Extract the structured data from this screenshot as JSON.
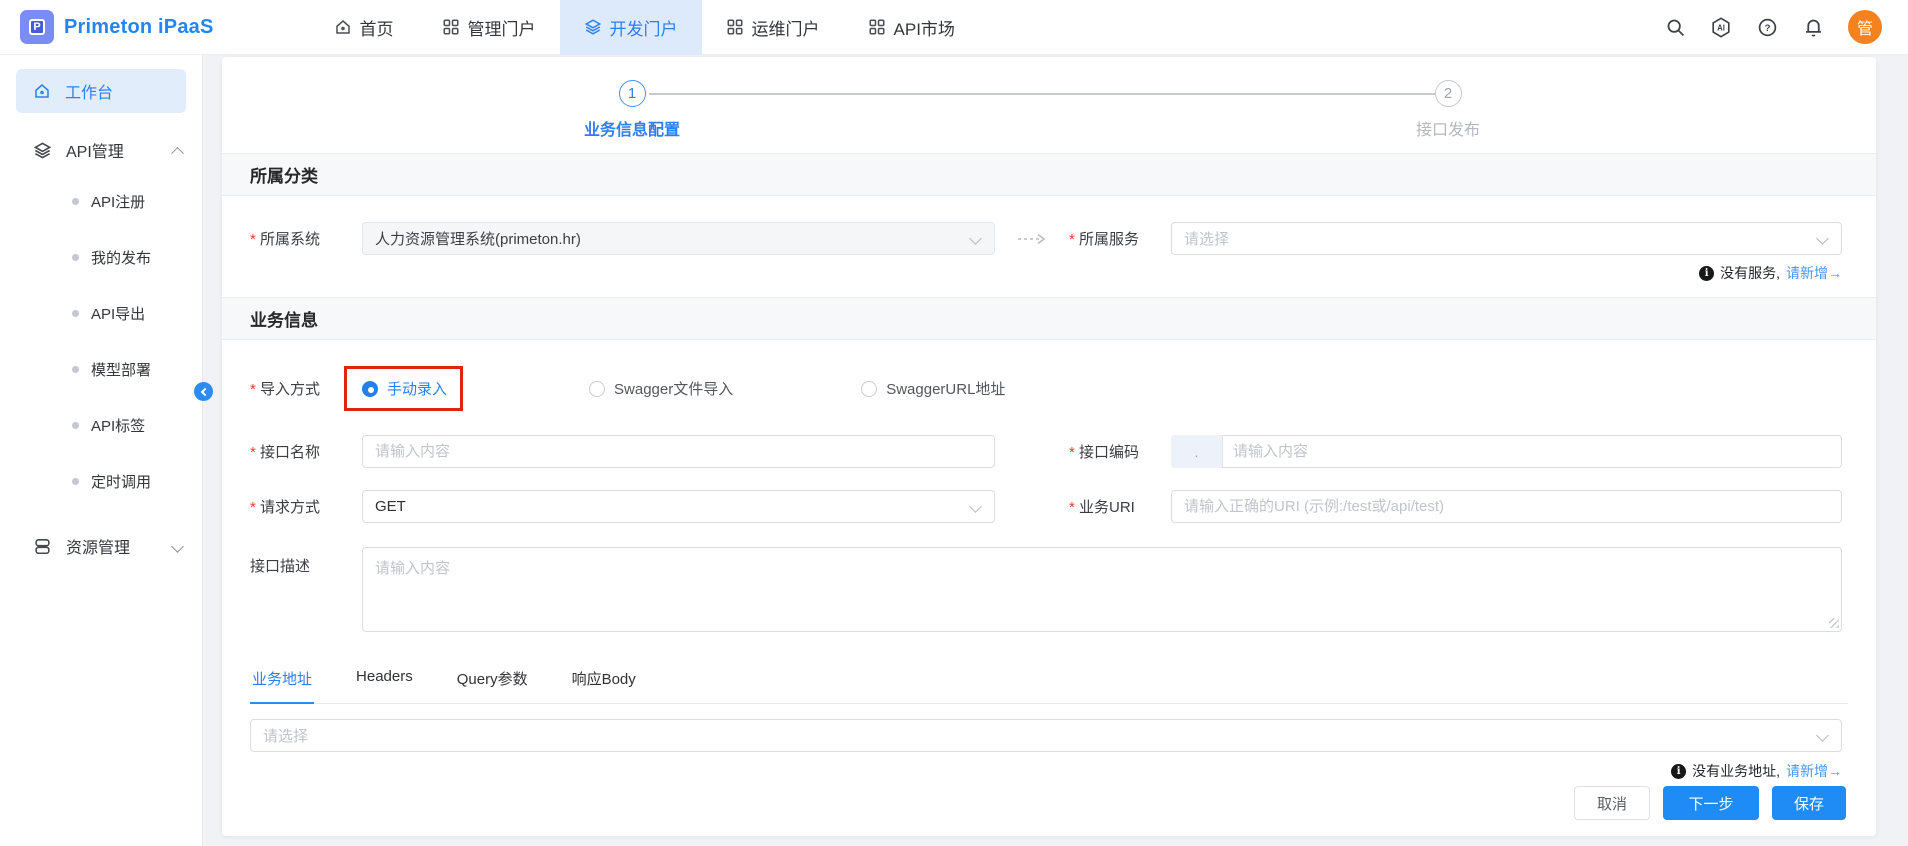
{
  "brand": {
    "name": "Primeton iPaaS"
  },
  "topnav": {
    "items": [
      {
        "label": "首页"
      },
      {
        "label": "管理门户"
      },
      {
        "label": "开发门户"
      },
      {
        "label": "运维门户"
      },
      {
        "label": "API市场"
      }
    ],
    "avatar_text": "管"
  },
  "sidebar": {
    "workbench_label": "工作台",
    "api_group_label": "API管理",
    "api_items": [
      {
        "label": "API注册"
      },
      {
        "label": "我的发布"
      },
      {
        "label": "API导出"
      },
      {
        "label": "模型部署"
      },
      {
        "label": "API标签"
      },
      {
        "label": "定时调用"
      }
    ],
    "resource_group_label": "资源管理"
  },
  "stepper": {
    "steps": [
      {
        "num": "1",
        "label": "业务信息配置"
      },
      {
        "num": "2",
        "label": "接口发布"
      }
    ]
  },
  "category": {
    "title": "所属分类",
    "system_label": "所属系统",
    "system_value": "人力资源管理系统(primeton.hr)",
    "service_label": "所属服务",
    "service_placeholder": "请选择",
    "note_text": "没有服务,",
    "note_link": "请新增→"
  },
  "business": {
    "title": "业务信息",
    "import_label": "导入方式",
    "import_options": [
      {
        "label": "手动录入"
      },
      {
        "label": "Swagger文件导入"
      },
      {
        "label": "SwaggerURL地址"
      }
    ],
    "name_label": "接口名称",
    "name_placeholder": "请输入内容",
    "code_label": "接口编码",
    "code_prefix": ".",
    "code_placeholder": "请输入内容",
    "method_label": "请求方式",
    "method_value": "GET",
    "uri_label": "业务URI",
    "uri_placeholder": "请输入正确的URI (示例:/test或/api/test)",
    "desc_label": "接口描述",
    "desc_placeholder": "请输入内容"
  },
  "tabs": [
    {
      "label": "业务地址"
    },
    {
      "label": "Headers"
    },
    {
      "label": "Query参数"
    },
    {
      "label": "响应Body"
    }
  ],
  "address": {
    "placeholder": "请选择",
    "note_text": "没有业务地址,",
    "note_link": "请新增→"
  },
  "footer": {
    "cancel": "取消",
    "next": "下一步",
    "save": "保存"
  },
  "colors": {
    "primary": "#2386f0",
    "highlight_red": "#e32117",
    "avatar_orange": "#f6821f"
  }
}
